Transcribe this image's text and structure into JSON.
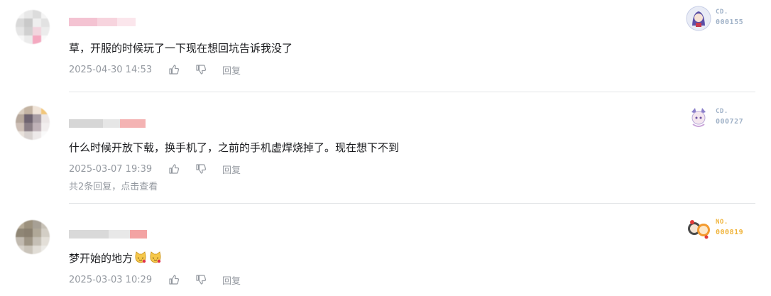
{
  "comments": [
    {
      "content": "草，开服的时候玩了一下现在想回坑告诉我没了",
      "time": "2025-04-30 14:53",
      "reply_label": "回复",
      "badge": {
        "label": "CD.",
        "number": "000155",
        "color": "#9fb1c7"
      },
      "name_colors": [
        "#f4c3d2",
        "#f7d4de",
        "#fbe6ec"
      ],
      "avatar_colors": [
        "#f3f3f3",
        "#e8e8e8",
        "#dcdcdc",
        "#f5f5f5",
        "#d9d9d9",
        "#c9c9c9",
        "#efefef",
        "#e2e2e2",
        "#e5e5e5",
        "#d0d0d0",
        "#f2d5de",
        "#ececec",
        "#f7f7f7",
        "#ebebeb",
        "#f4a9c0",
        "#fafafa"
      ]
    },
    {
      "content": "什么时候开放下载，换手机了，之前的手机虚焊烧掉了。现在想下不到",
      "time": "2025-03-07 19:39",
      "reply_label": "回复",
      "subreplies": {
        "count_text": "共2条回复，",
        "view_text": "点击查看"
      },
      "badge": {
        "label": "CD.",
        "number": "000727",
        "color": "#9fb1c7"
      },
      "name_colors": [
        "#d6d6d6",
        "#e6e6e6",
        "#f4b3b3"
      ],
      "avatar_colors": [
        "#d9cdbf",
        "#c4b4a3",
        "#f0e4d8",
        "#f2c67a",
        "#b6a89c",
        "#6f6470",
        "#a89da4",
        "#ece6e6",
        "#cdbfb6",
        "#8b7f86",
        "#bfb2b8",
        "#f2eeee",
        "#e9e2dc",
        "#d8d2d0",
        "#ede9e9",
        "#fafafa"
      ]
    },
    {
      "content": "梦开始的地方",
      "time": "2025-03-03 10:29",
      "reply_label": "回复",
      "badge": {
        "label": "NO.",
        "number": "000819",
        "color": "#f0b43c"
      },
      "name_colors": [
        "#d9d9d9",
        "#e8e8e8",
        "#f3a3a3"
      ],
      "avatar_colors": [
        "#b5aa96",
        "#9c917d",
        "#a7a095",
        "#c7c1b6",
        "#8f8675",
        "#8a8070",
        "#b0a898",
        "#d3cec5",
        "#c1bab0",
        "#9e9585",
        "#c5bfb5",
        "#e3dfd8",
        "#d7d2ca",
        "#cac4ba",
        "#e1ddd6",
        "#ecebe7"
      ]
    }
  ]
}
